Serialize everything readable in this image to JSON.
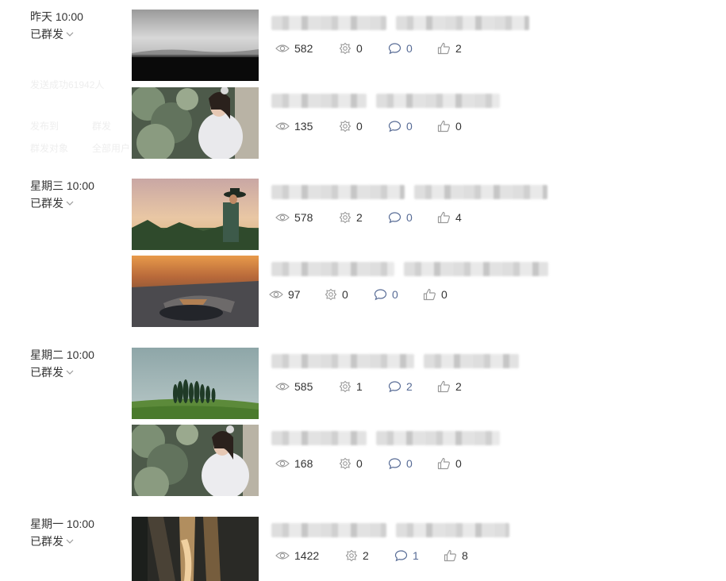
{
  "groups": [
    {
      "time": "昨天 10:00",
      "status": "已群发",
      "articles": [
        {
          "reads": "582",
          "shares": "0",
          "comments": "0",
          "likes": "2",
          "thumb": "dark-monochrome"
        },
        {
          "reads": "135",
          "shares": "0",
          "comments": "0",
          "likes": "0",
          "thumb": "woman-with-flowers"
        }
      ]
    },
    {
      "time": "星期三 10:00",
      "status": "已群发",
      "articles": [
        {
          "reads": "578",
          "shares": "2",
          "comments": "0",
          "likes": "4",
          "thumb": "farmer-sunset"
        },
        {
          "reads": "97",
          "shares": "0",
          "comments": "0",
          "likes": "0",
          "thumb": "aerial-airport"
        }
      ]
    },
    {
      "time": "星期二 10:00",
      "status": "已群发",
      "articles": [
        {
          "reads": "585",
          "shares": "1",
          "comments": "2",
          "likes": "2",
          "thumb": "cypress-field"
        },
        {
          "reads": "168",
          "shares": "0",
          "comments": "0",
          "likes": "0",
          "thumb": "woman-with-flowers"
        }
      ]
    },
    {
      "time": "星期一 10:00",
      "status": "已群发",
      "articles": [
        {
          "reads": "1422",
          "shares": "2",
          "comments": "1",
          "likes": "8",
          "thumb": "light-beams"
        }
      ]
    }
  ],
  "faded_text": {
    "line1": "发送成功61942人",
    "line2a": "发布到",
    "line2b": "群发",
    "line3a": "群发对象",
    "line3b": "全部用户"
  },
  "icons": {
    "reads": "eye-icon",
    "shares": "share-icon",
    "comments": "comment-icon",
    "likes": "thumbs-up-icon",
    "status_toggle": "chevron-down-icon"
  },
  "colors": {
    "comment_count": "#576b95",
    "icon_gray": "#9a9a9a",
    "text": "#333333"
  }
}
